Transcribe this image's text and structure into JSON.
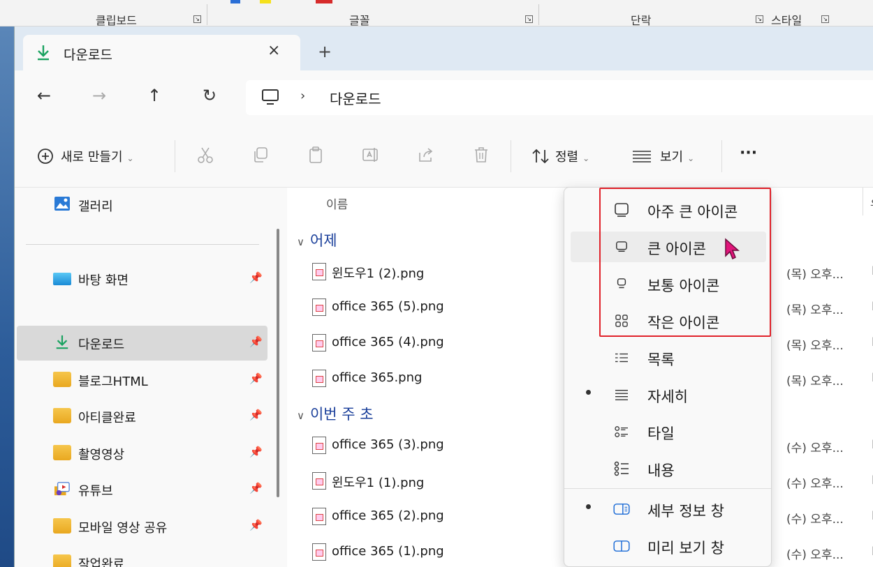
{
  "ribbon": {
    "groups": [
      "클립보드",
      "글꼴",
      "단락",
      "스타일"
    ]
  },
  "tab": {
    "title": "다운로드",
    "close": "×",
    "new_tab": "+"
  },
  "nav": {
    "back": "←",
    "forward": "→",
    "up": "↑",
    "refresh": "↻",
    "chevron": "›",
    "crumb": "다운로드"
  },
  "toolbar": {
    "new_label": "새로 만들기",
    "sort_label": "정렬",
    "view_label": "보기",
    "more": "···",
    "caret": "⌄"
  },
  "sidebar": {
    "gallery": "갤러리",
    "items": [
      {
        "label": "바탕 화면",
        "icon": "desktop-icon",
        "pinned": true
      },
      {
        "label": "다운로드",
        "icon": "download-icon",
        "pinned": true,
        "selected": true
      },
      {
        "label": "블로그HTML",
        "icon": "folder-icon",
        "pinned": true
      },
      {
        "label": "아티클완료",
        "icon": "folder-icon",
        "pinned": true
      },
      {
        "label": "촬영영상",
        "icon": "folder-icon",
        "pinned": true
      },
      {
        "label": "유튜브",
        "icon": "youtube-folder-icon",
        "pinned": true
      },
      {
        "label": "모바일 영상 공유",
        "icon": "folder-icon",
        "pinned": true
      },
      {
        "label": "작업완료",
        "icon": "folder-icon",
        "pinned": false
      }
    ],
    "pin_glyph": "📌"
  },
  "filelist": {
    "column_name": "이름",
    "column_type_partial": "유",
    "groups": [
      {
        "label": "어제",
        "files": [
          {
            "name": "윈도우1 (2).png",
            "date": "(목) 오후...",
            "type": "PN"
          },
          {
            "name": "office 365 (5).png",
            "date": "(목) 오후...",
            "type": "PN"
          },
          {
            "name": "office 365 (4).png",
            "date": "(목) 오후...",
            "type": "PN"
          },
          {
            "name": "office 365.png",
            "date": "(목) 오후...",
            "type": "PN"
          }
        ]
      },
      {
        "label": "이번 주 초",
        "files": [
          {
            "name": "office 365 (3).png",
            "date": "(수) 오후...",
            "type": "PN"
          },
          {
            "name": "윈도우1 (1).png",
            "date": "(수) 오후...",
            "type": "PN"
          },
          {
            "name": "office 365 (2).png",
            "date": "(수) 오후...",
            "type": "PN"
          },
          {
            "name": "office 365 (1).png",
            "date": "(수) 오후...",
            "type": "PN"
          }
        ]
      }
    ]
  },
  "view_menu": {
    "items": [
      {
        "label": "아주 큰 아이콘",
        "icon": "extra-large-icons-icon",
        "checked": false
      },
      {
        "label": "큰 아이콘",
        "icon": "large-icons-icon",
        "checked": false,
        "hovered": true
      },
      {
        "label": "보통 아이콘",
        "icon": "medium-icons-icon",
        "checked": false
      },
      {
        "label": "작은 아이콘",
        "icon": "small-icons-icon",
        "checked": false
      },
      {
        "label": "목록",
        "icon": "list-view-icon",
        "checked": false
      },
      {
        "label": "자세히",
        "icon": "details-view-icon",
        "checked": true
      },
      {
        "label": "타일",
        "icon": "tiles-view-icon",
        "checked": false
      },
      {
        "label": "내용",
        "icon": "content-view-icon",
        "checked": false
      },
      {
        "label": "세부 정보 창",
        "icon": "details-pane-icon",
        "checked": true
      },
      {
        "label": "미리 보기 창",
        "icon": "preview-pane-icon",
        "checked": false
      }
    ],
    "highlight_color": "#e0222a"
  },
  "colors": {
    "accent_download": "#1aa260",
    "group_header": "#1a3f9a",
    "tab_strip": "#dfe9f3",
    "cursor": "#e0157a"
  }
}
